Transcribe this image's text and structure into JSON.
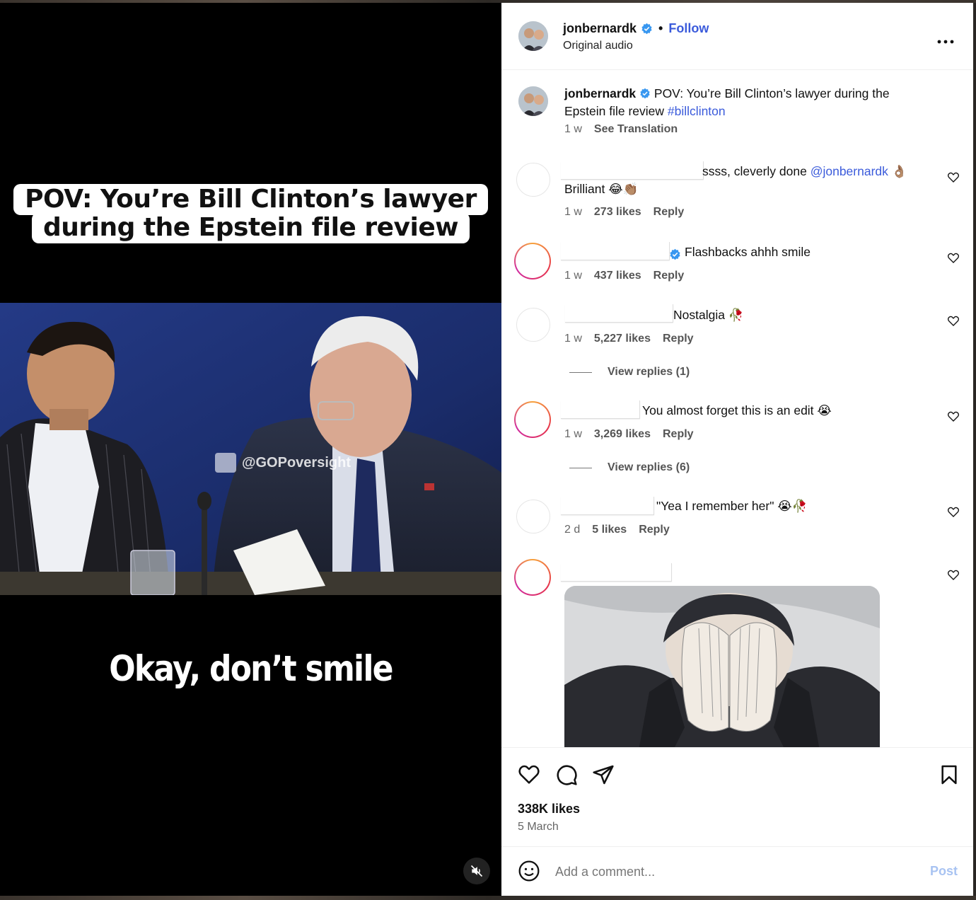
{
  "video": {
    "overlay_line1": "POV: You’re Bill Clinton’s lawyer",
    "overlay_line2": "during the Epstein file review",
    "watermark": "@GOPoversight",
    "subtitle": "Okay, don’t smile"
  },
  "header": {
    "username": "jonbernardk",
    "follow_label": "Follow",
    "separator": "•",
    "audio": "Original audio",
    "more_icon": "more-horizontal-icon"
  },
  "caption": {
    "username": "jonbernardk",
    "text": "POV: You’re Bill Clinton’s lawyer during the Epstein file review",
    "hashtag": "#billclinton",
    "time": "1 w",
    "see_translation": "See Translation"
  },
  "comments": [
    {
      "text_before": "ssss, cleverly done ",
      "mention": "@jonbernardk",
      "text_after": " 👌🏽",
      "line2": "Brilliant 😂👏🏽",
      "time": "1 w",
      "likes": "273 likes",
      "reply": "Reply"
    },
    {
      "text": "Flashbacks ahhh smile",
      "time": "1 w",
      "likes": "437 likes",
      "reply": "Reply",
      "verified": true
    },
    {
      "text": "Nostalgia 🥀",
      "time": "1 w",
      "likes": "5,227 likes",
      "reply": "Reply",
      "view_replies": "View replies (1)"
    },
    {
      "text": "You almost forget this is an edit 😭",
      "time": "1 w",
      "likes": "3,269 likes",
      "reply": "Reply",
      "view_replies": "View replies (6)"
    },
    {
      "text": "\"Yea I remember her\" 😭🥀",
      "time": "2 d",
      "likes": "5 likes",
      "reply": "Reply"
    },
    {
      "text": "",
      "gif": true
    }
  ],
  "actions": {
    "likes": "338K likes",
    "date": "5 March"
  },
  "composer": {
    "placeholder": "Add a comment...",
    "post_label": "Post"
  },
  "colors": {
    "link": "#3b5bdb",
    "verified": "#3897f0",
    "post_disabled": "#a8c3f2"
  }
}
